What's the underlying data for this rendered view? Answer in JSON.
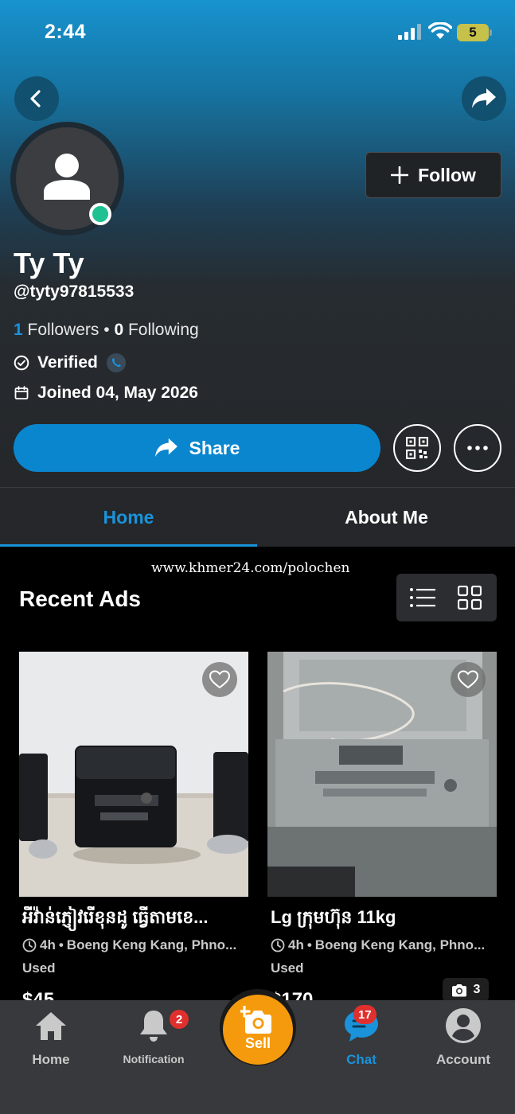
{
  "status_bar": {
    "time": "2:44",
    "battery": "5"
  },
  "profile": {
    "name": "Ty Ty",
    "handle": "@tyty97815533",
    "followers_count": "1",
    "followers_label": "Followers",
    "separator": "•",
    "following_count": "0",
    "following_label": "Following",
    "verified_label": "Verified",
    "joined_label": "Joined 04, May 2026",
    "online": true
  },
  "actions": {
    "follow_label": "Follow",
    "share_label": "Share"
  },
  "tabs": [
    {
      "label": "Home",
      "active": true
    },
    {
      "label": "About Me",
      "active": false
    }
  ],
  "watermark": "www.khmer24.com/polochen",
  "section": {
    "title": "Recent Ads",
    "view_mode": "grid"
  },
  "listings": [
    {
      "title": "អីវ៉ាន់ភ្ញៀវរើខុនដូ ធ្វើតាមខេ...",
      "time": "4h",
      "location": "Boeng Keng Kang, Phno...",
      "condition": "Used",
      "price": "$45",
      "photo_count": ""
    },
    {
      "title": "Lg ក្រុមហ៊ុន 11kg",
      "time": "4h",
      "location": "Boeng Keng Kang, Phno...",
      "condition": "Used",
      "price": "$170",
      "photo_count": "3"
    }
  ],
  "bottom_nav": {
    "home": "Home",
    "notification": "Notification",
    "notification_badge": "2",
    "sell": "Sell",
    "chat": "Chat",
    "chat_badge": "17",
    "account": "Account"
  },
  "colors": {
    "accent": "#1a93db",
    "share_button": "#0a86cf",
    "sell_button": "#f59a0c",
    "online": "#1fc193",
    "badge": "#e0302e"
  }
}
